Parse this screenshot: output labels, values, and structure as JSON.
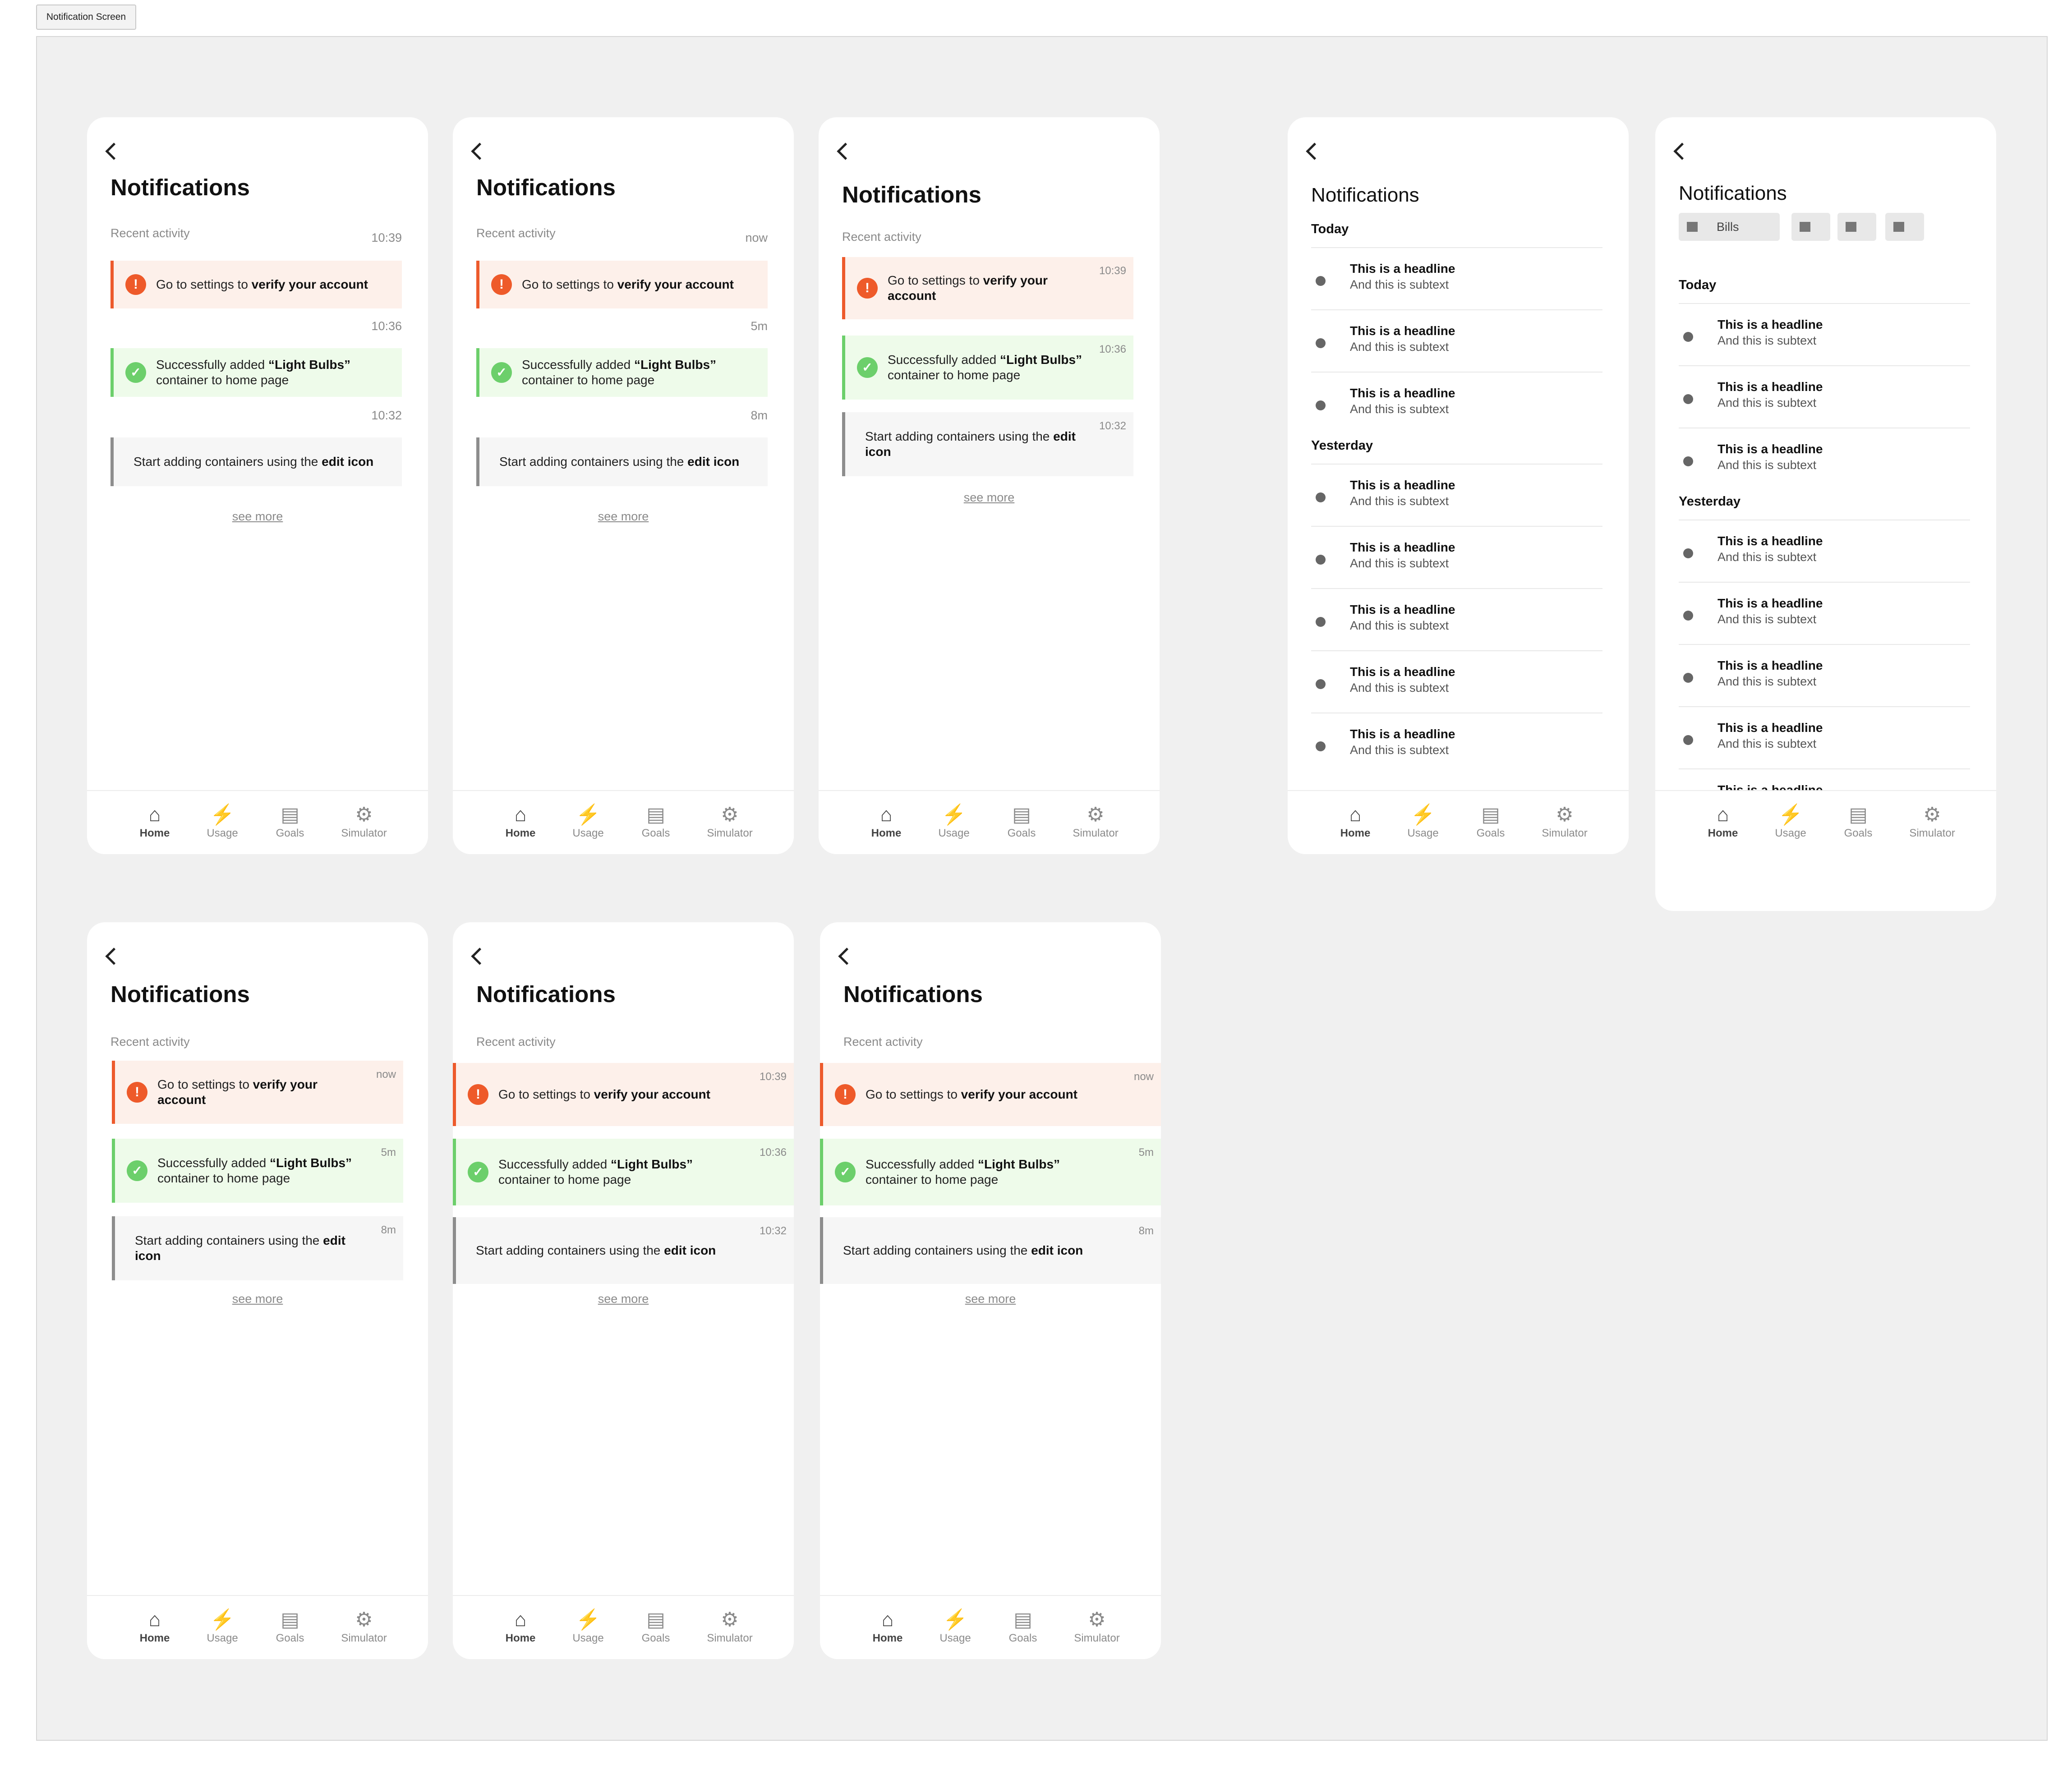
{
  "frame_label": "Notification Screen",
  "screens": {
    "title": "Notifications",
    "back_icon": "chevron-left-icon",
    "section_label": "Recent activity",
    "see_more": "see more",
    "alert": {
      "prefix": "Go to settings to ",
      "bold": "verify your account",
      "icon": "exclamation-icon",
      "color": "#ed5a2c"
    },
    "success": {
      "prefix": "Successfully added ",
      "bold": "“Light Bulbs”",
      "suffix": "container to home page",
      "icon": "check-icon",
      "color": "#6ccf6b"
    },
    "tip": {
      "prefix": "Start adding containers using the ",
      "bold": "edit icon",
      "bold_first": "edit",
      "bold_second": "icon"
    },
    "times_clock": [
      "10:39",
      "10:36",
      "10:32"
    ],
    "times_relative": [
      "now",
      "5m",
      "8m"
    ]
  },
  "tabbar": {
    "tabs": [
      {
        "label": "Home",
        "icon": "home-icon",
        "active": true
      },
      {
        "label": "Usage",
        "icon": "lightning-icon",
        "active": false
      },
      {
        "label": "Goals",
        "icon": "clipboard-icon",
        "active": false
      },
      {
        "label": "Simulator",
        "icon": "robot-icon",
        "active": false
      }
    ]
  },
  "list_screens": {
    "title": "Notifications",
    "today": "Today",
    "yesterday": "Yesterday",
    "headline": "This is a headline",
    "subtext": "And this is subtext",
    "partial_headline": "This is a headline",
    "filter_chip": "Bills"
  }
}
